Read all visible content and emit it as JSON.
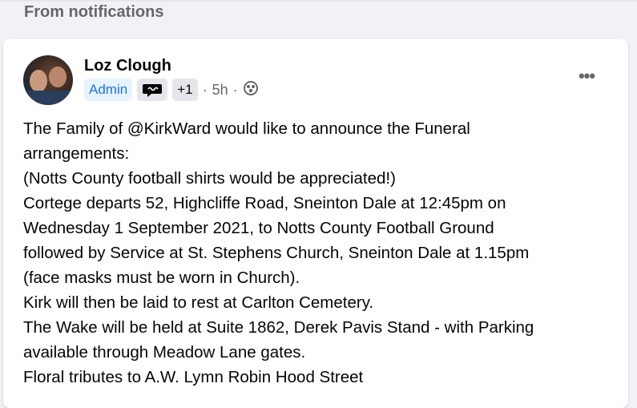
{
  "section_header": "From notifications",
  "post": {
    "author": "Loz Clough",
    "badges": {
      "admin": "Admin",
      "icon": "group-expert-icon",
      "plus": "+1"
    },
    "time": "5h",
    "separator": "·",
    "audience_icon": "group-members-icon",
    "more_icon": "more-options-icon",
    "more_label": "•••",
    "lines": [
      "The Family of @KirkWard would like to announce the Funeral",
      "arrangements:",
      "(Notts County football shirts would be appreciated!)",
      "Cortege departs 52, Highcliffe Road, Sneinton Dale at 12:45pm on",
      "Wednesday 1 September 2021, to Notts County Football Ground",
      "followed by Service at St. Stephens Church, Sneinton Dale at 1.15pm",
      "(face masks must be worn in Church).",
      "Kirk will then be laid to rest at Carlton Cemetery.",
      "The Wake will be held at Suite 1862, Derek Pavis Stand - with Parking",
      "available through Meadow Lane gates.",
      "Floral tributes to A.W. Lymn Robin Hood Street"
    ]
  }
}
